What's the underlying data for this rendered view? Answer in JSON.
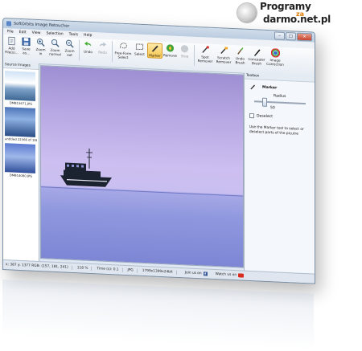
{
  "watermark": {
    "line1": "Programy",
    "line2": "za",
    "line3": "darmo.net.pl"
  },
  "window": {
    "title": "SoftOrbits Image Retoucher",
    "controls": [
      "–",
      "□",
      "✕"
    ]
  },
  "menu": [
    "File",
    "Edit",
    "View",
    "Selection",
    "Tools",
    "Help"
  ],
  "toolbar": [
    {
      "label": "Add File(s)...",
      "icon": "add-file-icon",
      "state": "normal"
    },
    {
      "label": "Save as...",
      "icon": "save-icon",
      "state": "normal"
    },
    {
      "label": "Zoom in",
      "icon": "zoom-in-icon",
      "state": "normal"
    },
    {
      "label": "Zoom normal",
      "icon": "zoom-normal-icon",
      "state": "normal"
    },
    {
      "label": "Zoom out",
      "icon": "zoom-out-icon",
      "state": "normal"
    },
    {
      "label": "Undo",
      "icon": "undo-icon",
      "state": "normal"
    },
    {
      "label": "Redo",
      "icon": "redo-icon",
      "state": "disabled"
    },
    {
      "label": "Free-Form Select",
      "icon": "freeform-select-icon",
      "state": "normal"
    },
    {
      "label": "Select",
      "icon": "select-icon",
      "state": "normal"
    },
    {
      "label": "Marker",
      "icon": "marker-icon",
      "state": "active"
    },
    {
      "label": "Remove",
      "icon": "remove-icon",
      "state": "normal"
    },
    {
      "label": "Stop",
      "icon": "stop-icon",
      "state": "disabled"
    },
    {
      "label": "Spot Remover",
      "icon": "spot-remover-icon",
      "state": "normal"
    },
    {
      "label": "Scratch Remover",
      "icon": "scratch-remover-icon",
      "state": "normal"
    },
    {
      "label": "Undo Brush",
      "icon": "undo-brush-icon",
      "state": "normal"
    },
    {
      "label": "Concealer Brush",
      "icon": "concealer-brush-icon",
      "state": "normal"
    },
    {
      "label": "Image Correction",
      "icon": "image-correction-icon",
      "state": "normal"
    }
  ],
  "source_panel": {
    "title": "Source Images",
    "images": [
      {
        "caption": "DMB13671.JPG"
      },
      {
        "caption": "untitled 22366 of 186).jpg"
      },
      {
        "caption": "DMB14080.JPG"
      }
    ]
  },
  "toolbox": {
    "title": "Toolbox",
    "tool_name": "Marker",
    "radius_label": "Radius",
    "radius_value": "50",
    "deselect_label": "Deselect",
    "help_text": "Use the Marker tool to select or deselect parts of the picutre"
  },
  "status": {
    "coords": "x: 387 y: 1377  RGB: (157, 181, 241)",
    "zoom": "118 %",
    "time": "Time (s): 0.1",
    "format": "JPG",
    "dims": "1799x1399x24bit",
    "join": "Join us on",
    "watch": "Watch us on"
  },
  "colors": {
    "accent": "#f6c64c",
    "chrome": "#dfe8f3",
    "sky_top": "#9e8fd3",
    "sea": "#7c86d4"
  }
}
